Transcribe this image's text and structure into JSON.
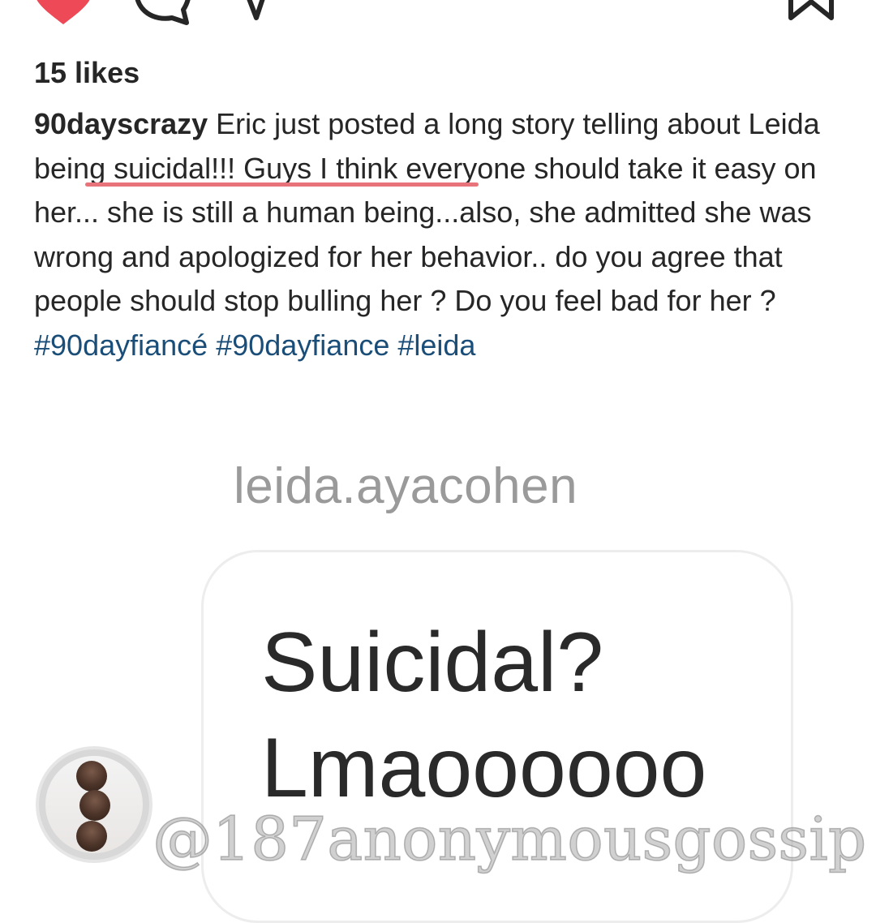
{
  "post": {
    "likes": "15 likes",
    "caption": {
      "username": "90dayscrazy",
      "text_before_highlight": " Eric just posted a long story telling abo",
      "highlighted_text": "ut Leida being suicidal!!!",
      "text_after_highlight": " Guys I think everyone should take it easy on her... she is still a human being...also, she admitted she was wrong and apologized for her behavior.. do you agree that people should stop bulling her ? Do you feel bad for her ? ",
      "hashtags": [
        "#90dayfiancé",
        "#90dayfiance",
        "#leida"
      ]
    },
    "highlight_color": "#e8737a",
    "hashtag_color": "#1a4e78"
  },
  "story": {
    "author": "leida.ayacohen",
    "message": "Suicidal?\nLmaoooooo"
  },
  "watermark": {
    "text": "@187anonymousgossip"
  },
  "icons": {
    "like": "heart-icon",
    "comment": "comment-icon",
    "share": "share-icon",
    "save": "bookmark-icon"
  }
}
